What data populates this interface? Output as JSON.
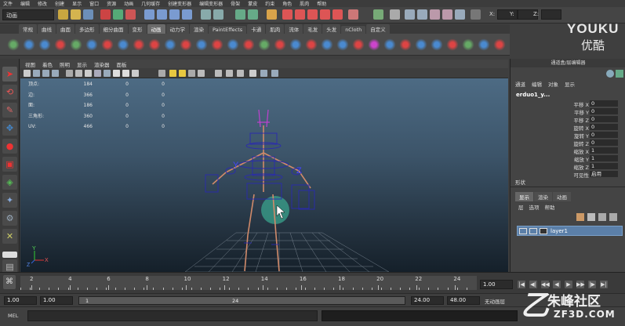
{
  "menubar": {
    "items": [
      "文件",
      "编辑",
      "修改",
      "创建",
      "显示",
      "窗口",
      "资源",
      "动画",
      "几何缓存",
      "创建变形器",
      "编辑变形器",
      "骨架",
      "蒙皮",
      "约束",
      "角色",
      "肌肉",
      "帮助"
    ]
  },
  "statusline": {
    "mode": "动画",
    "x_label": "X:",
    "y_label": "Y:",
    "z_label": "Z:"
  },
  "shelf": {
    "tabs": [
      "常规",
      "曲线",
      "曲面",
      "多边形",
      "细分曲面",
      "变形",
      "动画",
      "动力学",
      "渲染",
      "PaintEffects",
      "卡通",
      "肌肉",
      "流体",
      "毛发",
      "头发",
      "nCloth",
      "自定义"
    ],
    "active_tab": 6
  },
  "logo": {
    "line1": "YOUKU",
    "line2": "优酷"
  },
  "viewport": {
    "menus": [
      "视图",
      "着色",
      "照明",
      "显示",
      "渲染器",
      "面板"
    ],
    "hud": [
      {
        "label": "顶点:",
        "v1": "184",
        "v2": "0",
        "v3": "0"
      },
      {
        "label": "边:",
        "v1": "366",
        "v2": "0",
        "v3": "0"
      },
      {
        "label": "面:",
        "v1": "186",
        "v2": "0",
        "v3": "0"
      },
      {
        "label": "三角形:",
        "v1": "360",
        "v2": "0",
        "v3": "0"
      },
      {
        "label": "UV:",
        "v1": "466",
        "v2": "0",
        "v3": "0"
      }
    ],
    "axis": {
      "x": "X",
      "y": "Y",
      "z": "Z"
    },
    "rig_labels": {
      "y": "Y",
      "z": "Z"
    }
  },
  "channelbox": {
    "title": "通道盒/层编辑器",
    "menus": [
      "通道",
      "编辑",
      "对象",
      "显示"
    ],
    "object": "erduo1_y...",
    "attributes": [
      {
        "name": "平移 X",
        "value": "0"
      },
      {
        "name": "平移 Y",
        "value": "0"
      },
      {
        "name": "平移 Z",
        "value": "0"
      },
      {
        "name": "旋转 X",
        "value": "0"
      },
      {
        "name": "旋转 Y",
        "value": "0"
      },
      {
        "name": "旋转 Z",
        "value": "0"
      },
      {
        "name": "缩放 X",
        "value": "1"
      },
      {
        "name": "缩放 Y",
        "value": "1"
      },
      {
        "name": "缩放 Z",
        "value": "1"
      },
      {
        "name": "可见性",
        "value": "启用"
      }
    ],
    "section": "形状",
    "layer_tabs": [
      "显示",
      "渲染",
      "动画"
    ],
    "layer_menus": [
      "层",
      "选项",
      "帮助"
    ],
    "layer_name": "layer1"
  },
  "timeline": {
    "ticks": [
      "2",
      "4",
      "6",
      "8",
      "10",
      "12",
      "14",
      "16",
      "18",
      "20",
      "22",
      "24"
    ],
    "current_frame": "1.00",
    "playback_buttons": [
      "|◀",
      "◀|",
      "◀◀",
      "◀",
      "▶",
      "▶▶",
      "|▶",
      "▶|"
    ]
  },
  "range": {
    "start": "1.00",
    "start2": "1.00",
    "slider_start": "1",
    "slider_end": "24",
    "end": "24.00",
    "end2": "48.00",
    "char_label": "无动画层"
  },
  "cmdline": {
    "label": "MEL"
  },
  "watermark": {
    "line1": "朱峰社区",
    "line2": "ZF3D.COM",
    "glyph": "乙"
  },
  "colors": {
    "accent": "#5b7fa8",
    "viewport_top": "#4d6b84",
    "joint": "#d08a6a",
    "ctrl": "#2a2ab0"
  }
}
